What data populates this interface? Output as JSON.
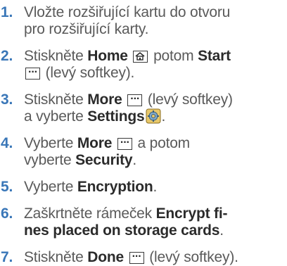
{
  "steps": [
    {
      "num": "1.",
      "parts": [
        "Vložte rozšiřující kartu do otvoru",
        "pro rozšiřující karty."
      ]
    },
    {
      "num": "2.",
      "t1": "Stiskněte",
      "b1": "Home",
      "t2": "potom",
      "b2": "Start",
      "t3": "(levý softkey)."
    },
    {
      "num": "3.",
      "t1": "Stiskněte",
      "b1": "More",
      "t2": "(levý softkey)",
      "t3": "a vyberte",
      "b2": "Settings",
      "t4": "."
    },
    {
      "num": "4.",
      "t1": "Vyberte",
      "b1": "More",
      "t2": "a potom",
      "t3": "vyberte",
      "b2": "Security",
      "t4": "."
    },
    {
      "num": "5.",
      "t1": "Vyberte",
      "b1": "Encryption",
      "t2": "."
    },
    {
      "num": "6.",
      "t1": "Zaškrtněte rámeček",
      "b1": "Encrypt fi-",
      "b2": "nes placed on storage cards",
      "t2": "."
    },
    {
      "num": "7.",
      "t1": "Stiskněte",
      "b1": "Done",
      "t2": "(levý softkey)."
    }
  ],
  "icons": {
    "home": "home-icon",
    "softkey": "softkey-dots-icon",
    "settings": "settings-icon"
  },
  "colors": {
    "number": "#3a77b8",
    "text": "#5a5a5a",
    "bold": "#2b2b2b"
  }
}
